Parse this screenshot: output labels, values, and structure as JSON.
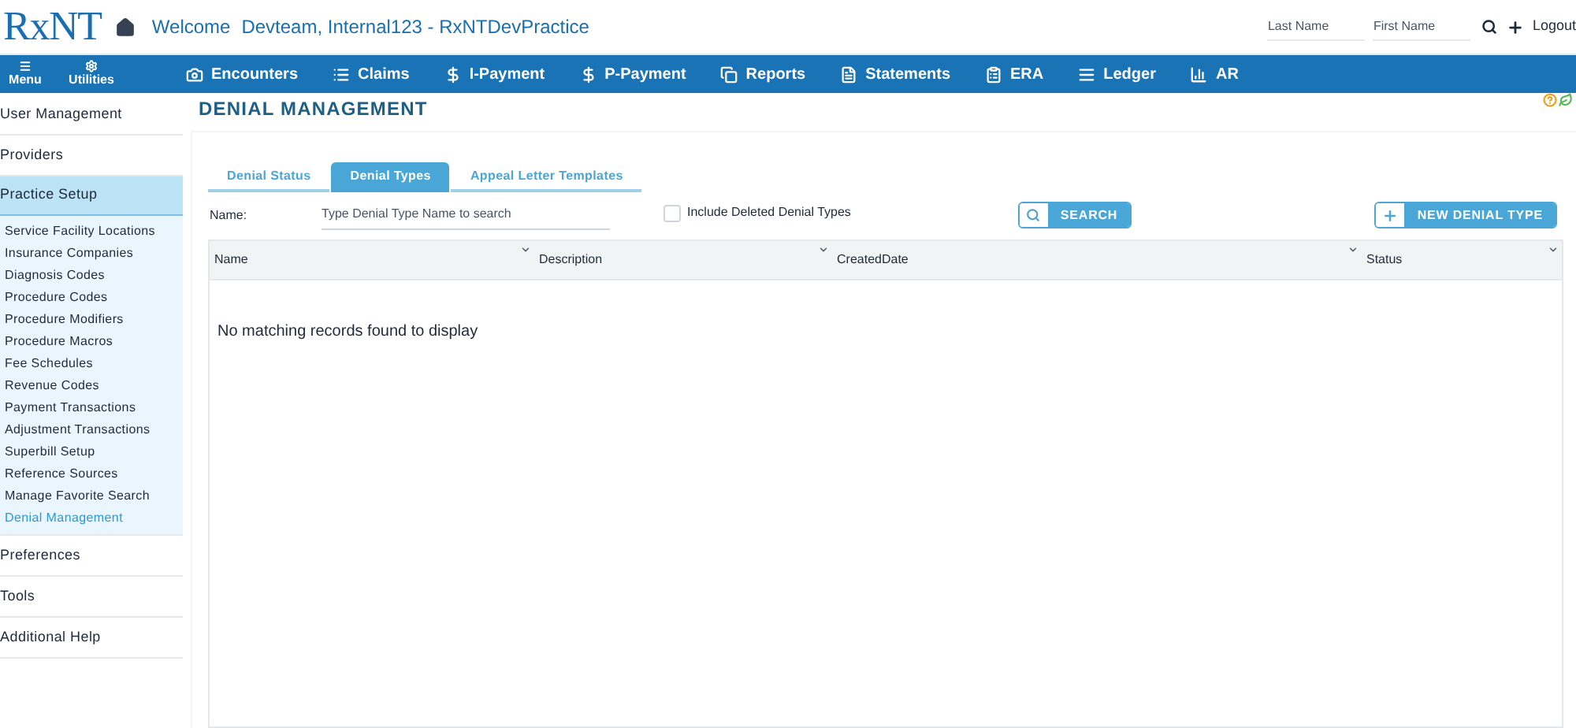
{
  "header": {
    "logo": "RxNT",
    "welcome": "Welcome",
    "user": "Devteam, Internal123 - RxNTDevPractice",
    "last_name": {
      "placeholder": "Last Name"
    },
    "first_name": {
      "placeholder": "First Name"
    },
    "logout": "Logout"
  },
  "menu_buttons": [
    {
      "label": "Menu",
      "kind": "menu"
    },
    {
      "label": "Utilities",
      "kind": "gear"
    }
  ],
  "nav": [
    {
      "label": "Encounters",
      "kind": "camera"
    },
    {
      "label": "Claims",
      "kind": "list"
    },
    {
      "label": "I-Payment",
      "kind": "dollar"
    },
    {
      "label": "P-Payment",
      "kind": "dollar"
    },
    {
      "label": "Reports",
      "kind": "copy"
    },
    {
      "label": "Statements",
      "kind": "doc"
    },
    {
      "label": "ERA",
      "kind": "clipboard"
    },
    {
      "label": "Ledger",
      "kind": "lines"
    },
    {
      "label": "AR",
      "kind": "bars"
    }
  ],
  "sidebar": {
    "items": [
      {
        "label": "User Management",
        "expanded": false
      },
      {
        "label": "Providers",
        "expanded": false
      },
      {
        "label": "Practice Setup",
        "expanded": true,
        "children": [
          {
            "label": "Service Facility Locations",
            "selected": false
          },
          {
            "label": "Insurance Companies",
            "selected": false
          },
          {
            "label": "Diagnosis Codes",
            "selected": false
          },
          {
            "label": "Procedure Codes",
            "selected": false
          },
          {
            "label": "Procedure Modifiers",
            "selected": false
          },
          {
            "label": "Procedure Macros",
            "selected": false
          },
          {
            "label": "Fee Schedules",
            "selected": false
          },
          {
            "label": "Revenue Codes",
            "selected": false
          },
          {
            "label": "Payment Transactions",
            "selected": false
          },
          {
            "label": "Adjustment Transactions",
            "selected": false
          },
          {
            "label": "Superbill Setup",
            "selected": false
          },
          {
            "label": "Reference Sources",
            "selected": false
          },
          {
            "label": "Manage Favorite Search",
            "selected": false
          },
          {
            "label": "Denial Management",
            "selected": true
          }
        ]
      },
      {
        "label": "Preferences",
        "expanded": false
      },
      {
        "label": "Tools",
        "expanded": false
      },
      {
        "label": "Additional Help",
        "expanded": false
      }
    ]
  },
  "page_title": "DENIAL MANAGEMENT",
  "tabs": [
    {
      "label": "Denial Status",
      "selected": false
    },
    {
      "label": "Denial Types",
      "selected": true
    },
    {
      "label": "Appeal Letter Templates",
      "selected": false
    }
  ],
  "filter": {
    "name_label": "Name:",
    "name_field": {
      "placeholder": "Type Denial Type Name to search"
    },
    "include_deleted": {
      "label": "Include Deleted Denial Types",
      "checked": false
    },
    "search_button": "SEARCH",
    "new_button": "NEW DENIAL TYPE"
  },
  "table": {
    "columns": [
      "Name",
      "Description",
      "CreatedDate",
      "Status"
    ],
    "empty_message": "No matching records found to display"
  }
}
